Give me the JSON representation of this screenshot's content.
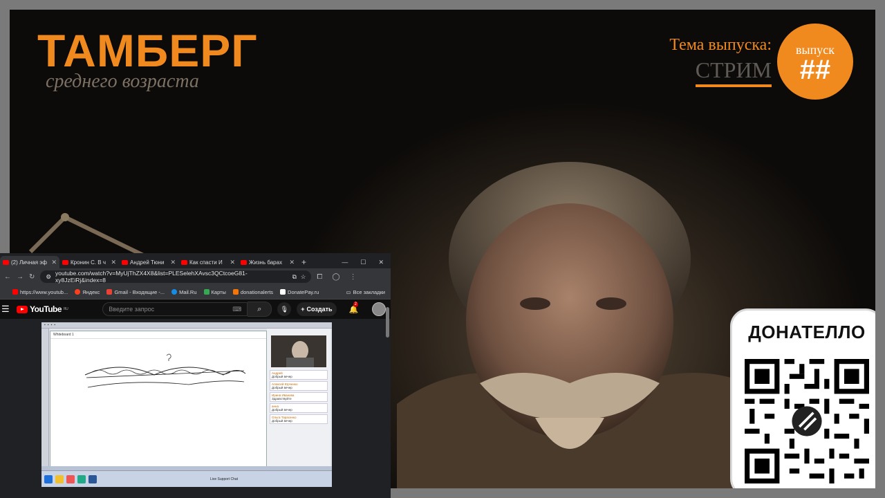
{
  "brand": {
    "title": "ТАМБЕРГ",
    "subtitle": "среднего возраста"
  },
  "topic": {
    "label": "Тема выпуска:",
    "value": "СТРИМ"
  },
  "episode": {
    "label": "выпуск",
    "number": "##"
  },
  "donate": {
    "title": "ДОНАТЕЛЛО"
  },
  "browser": {
    "tabs": [
      {
        "label": "(2) Личная эф",
        "active": true
      },
      {
        "label": "Кронин С. В ч",
        "active": false
      },
      {
        "label": "Андрей Тюни",
        "active": false
      },
      {
        "label": "Как спасти И",
        "active": false
      },
      {
        "label": "Жизнь барах",
        "active": false
      }
    ],
    "new_tab": "+",
    "url": "youtube.com/watch?v=MyUjThZX4X8&list=PLESelehXAvsc3QCtcoeG81-xy8JzEiRj&index=8",
    "bookmarks": [
      {
        "label": "https://www.youtub...",
        "color": "#ff0000"
      },
      {
        "label": "Яндекс",
        "color": "#fc3f1d"
      },
      {
        "label": "Gmail - Входящие -...",
        "color": "#ea4335"
      },
      {
        "label": "Mail.Ru",
        "color": "#168de2"
      },
      {
        "label": "Карты",
        "color": "#34a853"
      },
      {
        "label": "donationalerts",
        "color": "#f57507"
      },
      {
        "label": "DonatePay.ru",
        "color": "#ffffff"
      }
    ],
    "all_bookmarks": "Все закладки",
    "youtube": {
      "logo": "YouTube",
      "region": "RU",
      "search_placeholder": "Введите запрос",
      "create_label": "Создать",
      "notifications": "2"
    }
  },
  "video": {
    "board_title": "Whiteboard 1",
    "chat": [
      {
        "name": "Андрей",
        "text": "Добрый вечер"
      },
      {
        "name": "Алексей Юрченко",
        "text": "Добрый вечер"
      },
      {
        "name": "Ирина Иванова",
        "text": "Здравствуйте"
      },
      {
        "name": "анна",
        "text": "Добрый вечер"
      },
      {
        "name": "Ольга Тарасенко",
        "text": "Добрый вечер"
      }
    ],
    "taskbar_label": "Live Support Chat"
  }
}
